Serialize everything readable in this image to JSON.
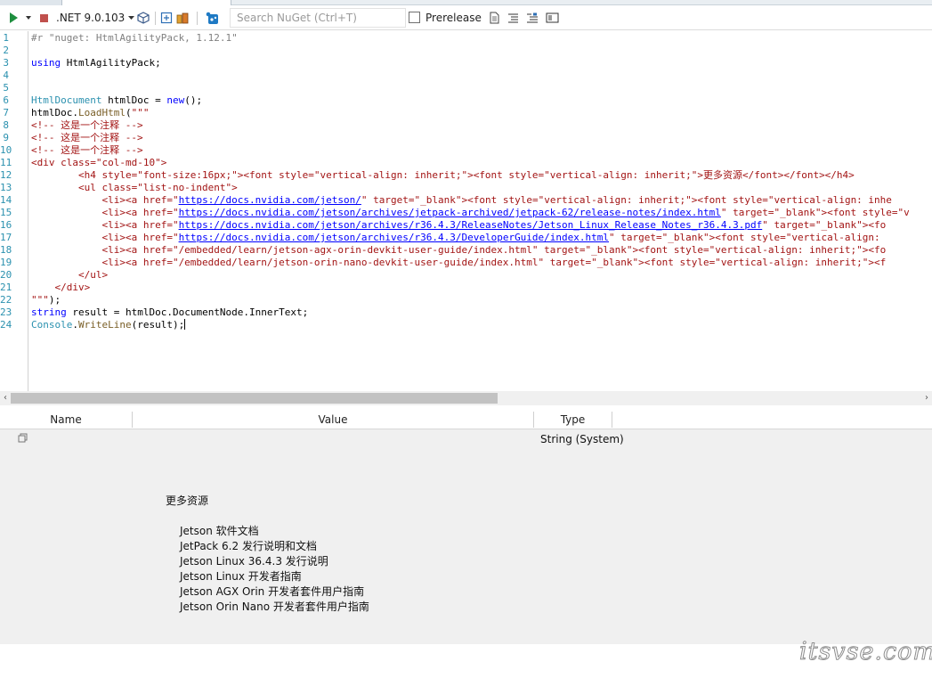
{
  "toolbar": {
    "run_icon": "play-icon",
    "dropdown_icon": "dropdown-caret-icon",
    "stop_icon": "stop-square-icon",
    "runtime": ".NET 9.0.103",
    "search_placeholder": "Search NuGet (Ctrl+T)",
    "prerelease_label": "Prerelease",
    "prerelease_checked": false
  },
  "editor": {
    "line_numbers": [
      "1",
      "2",
      "3",
      "4",
      "5",
      "6",
      "7",
      "8",
      "9",
      "10",
      "11",
      "12",
      "13",
      "14",
      "15",
      "16",
      "17",
      "18",
      "19",
      "20",
      "21",
      "22",
      "23",
      "24"
    ],
    "code": {
      "l1": "#r \"nuget: HtmlAgilityPack, 1.12.1\"",
      "l3_kw": "using",
      "l3_rest": " HtmlAgilityPack;",
      "l6_type": "HtmlDocument",
      "l6_mid": " htmlDoc = ",
      "l6_kw": "new",
      "l6_end": "();",
      "l7_obj": "htmlDoc.",
      "l7_meth": "LoadHtml",
      "l7_paren": "(",
      "l7_str": "\"\"\"",
      "l8": "<!-- 这是一个注释 -->",
      "l9": "<!-- 这是一个注释 -->",
      "l10": "<!-- 这是一个注释 -->",
      "l11": "<div class=\"col-md-10\">",
      "l12": "        <h4 style=\"font-size:16px;\"><font style=\"vertical-align: inherit;\"><font style=\"vertical-align: inherit;\">更多资源</font></font></h4>",
      "l13": "        <ul class=\"list-no-indent\">",
      "l14_a": "            <li><a href=\"",
      "l14_url": "https://docs.nvidia.com/jetson/",
      "l14_b": "\" target=\"_blank\"><font style=\"vertical-align: inherit;\"><font style=\"vertical-align: inhe",
      "l15_a": "            <li><a href=\"",
      "l15_url": "https://docs.nvidia.com/jetson/archives/jetpack-archived/jetpack-62/release-notes/index.html",
      "l15_b": "\" target=\"_blank\"><font style=\"v",
      "l16_a": "            <li><a href=\"",
      "l16_url": "https://docs.nvidia.com/jetson/archives/r36.4.3/ReleaseNotes/Jetson_Linux_Release_Notes_r36.4.3.pdf",
      "l16_b": "\" target=\"_blank\"><fo",
      "l17_a": "            <li><a href=\"",
      "l17_url": "https://docs.nvidia.com/jetson/archives/r36.4.3/DeveloperGuide/index.html",
      "l17_b": "\" target=\"_blank\"><font style=\"vertical-align:",
      "l18": "            <li><a href=\"/embedded/learn/jetson-agx-orin-devkit-user-guide/index.html\" target=\"_blank\"><font style=\"vertical-align: inherit;\"><fo",
      "l19": "            <li><a href=\"/embedded/learn/jetson-orin-nano-devkit-user-guide/index.html\" target=\"_blank\"><font style=\"vertical-align: inherit;\"><f",
      "l20": "        </ul>",
      "l21": "    </div>",
      "l22_str": "\"\"\"",
      "l22_end": ");",
      "l23_kw": "string",
      "l23_rest": " result = htmlDoc.DocumentNode.InnerText;",
      "l24_type": "Console",
      "l24_dot": ".",
      "l24_meth": "WriteLine",
      "l24_rest": "(result);"
    }
  },
  "results": {
    "columns": [
      "Name",
      "Value",
      "Type"
    ],
    "row_icon": "copy-icon",
    "type_value": "String (System)",
    "heading": "更多资源",
    "items": [
      "Jetson 软件文档",
      "JetPack 6.2 发行说明和文档",
      "Jetson Linux 36.4.3 发行说明",
      "Jetson Linux 开发者指南",
      "Jetson AGX Orin 开发者套件用户指南",
      "Jetson Orin Nano 开发者套件用户指南"
    ]
  },
  "watermark": "itsvse.com"
}
